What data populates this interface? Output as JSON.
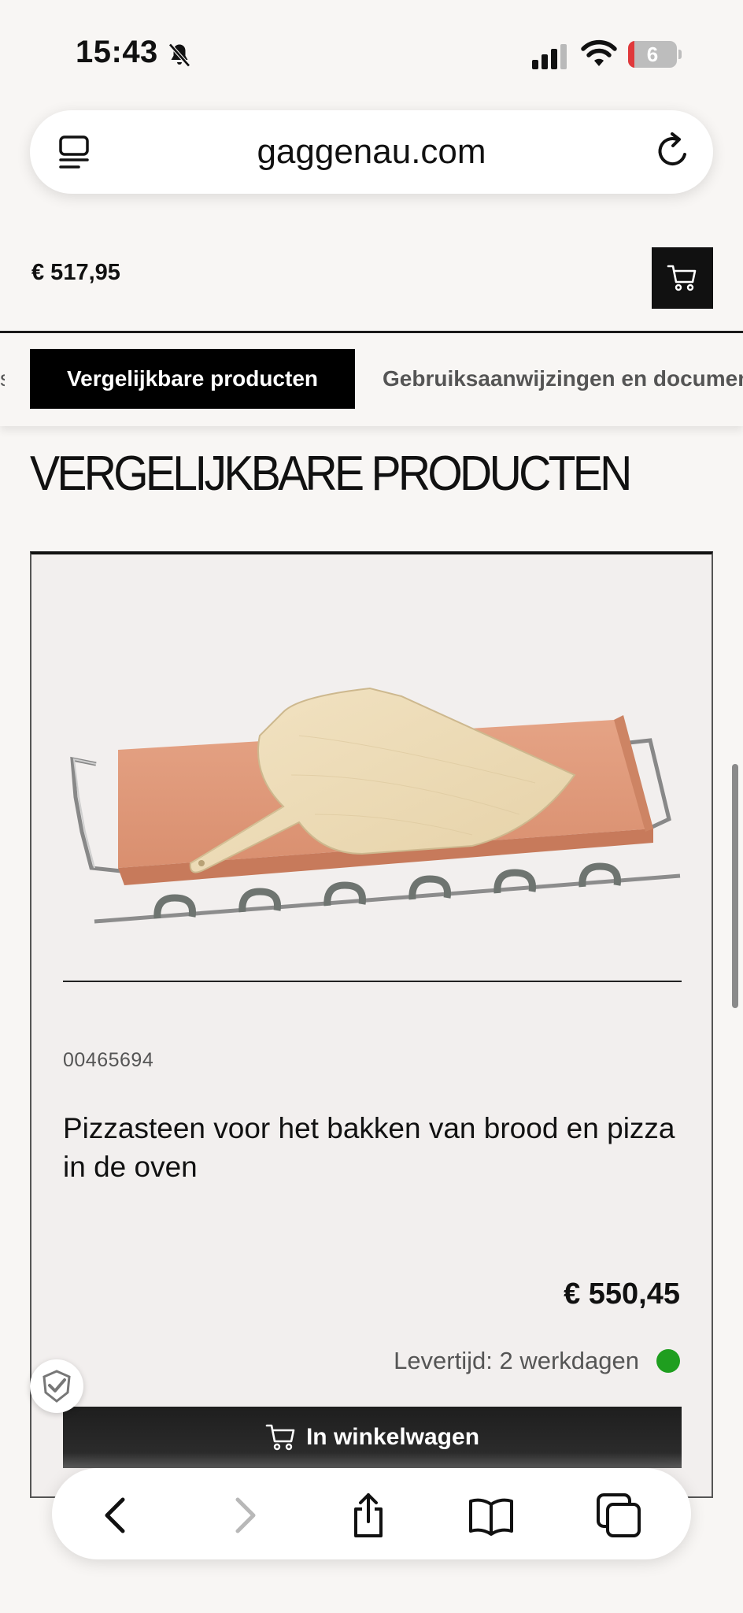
{
  "status_bar": {
    "time": "15:43",
    "battery": "6"
  },
  "browser": {
    "url": "gaggenau.com"
  },
  "header": {
    "price": "€ 517,95"
  },
  "tabs": {
    "active": "Vergelijkbare producten",
    "inactive": "Gebruiksaanwijzingen en documenten"
  },
  "section": {
    "title": "VERGELIJKBARE PRODUCTEN"
  },
  "product": {
    "sku": "00465694",
    "title": "Pizzasteen voor het bakken van brood en pizza in de oven",
    "price": "€ 550,45",
    "delivery": "Levertijd: 2 werkdagen",
    "add_to_cart": "In winkelwagen"
  },
  "colors": {
    "accent": "#000000",
    "delivery_ok": "#1f9e1f",
    "background": "#f8f6f4",
    "card": "#f2efee"
  }
}
